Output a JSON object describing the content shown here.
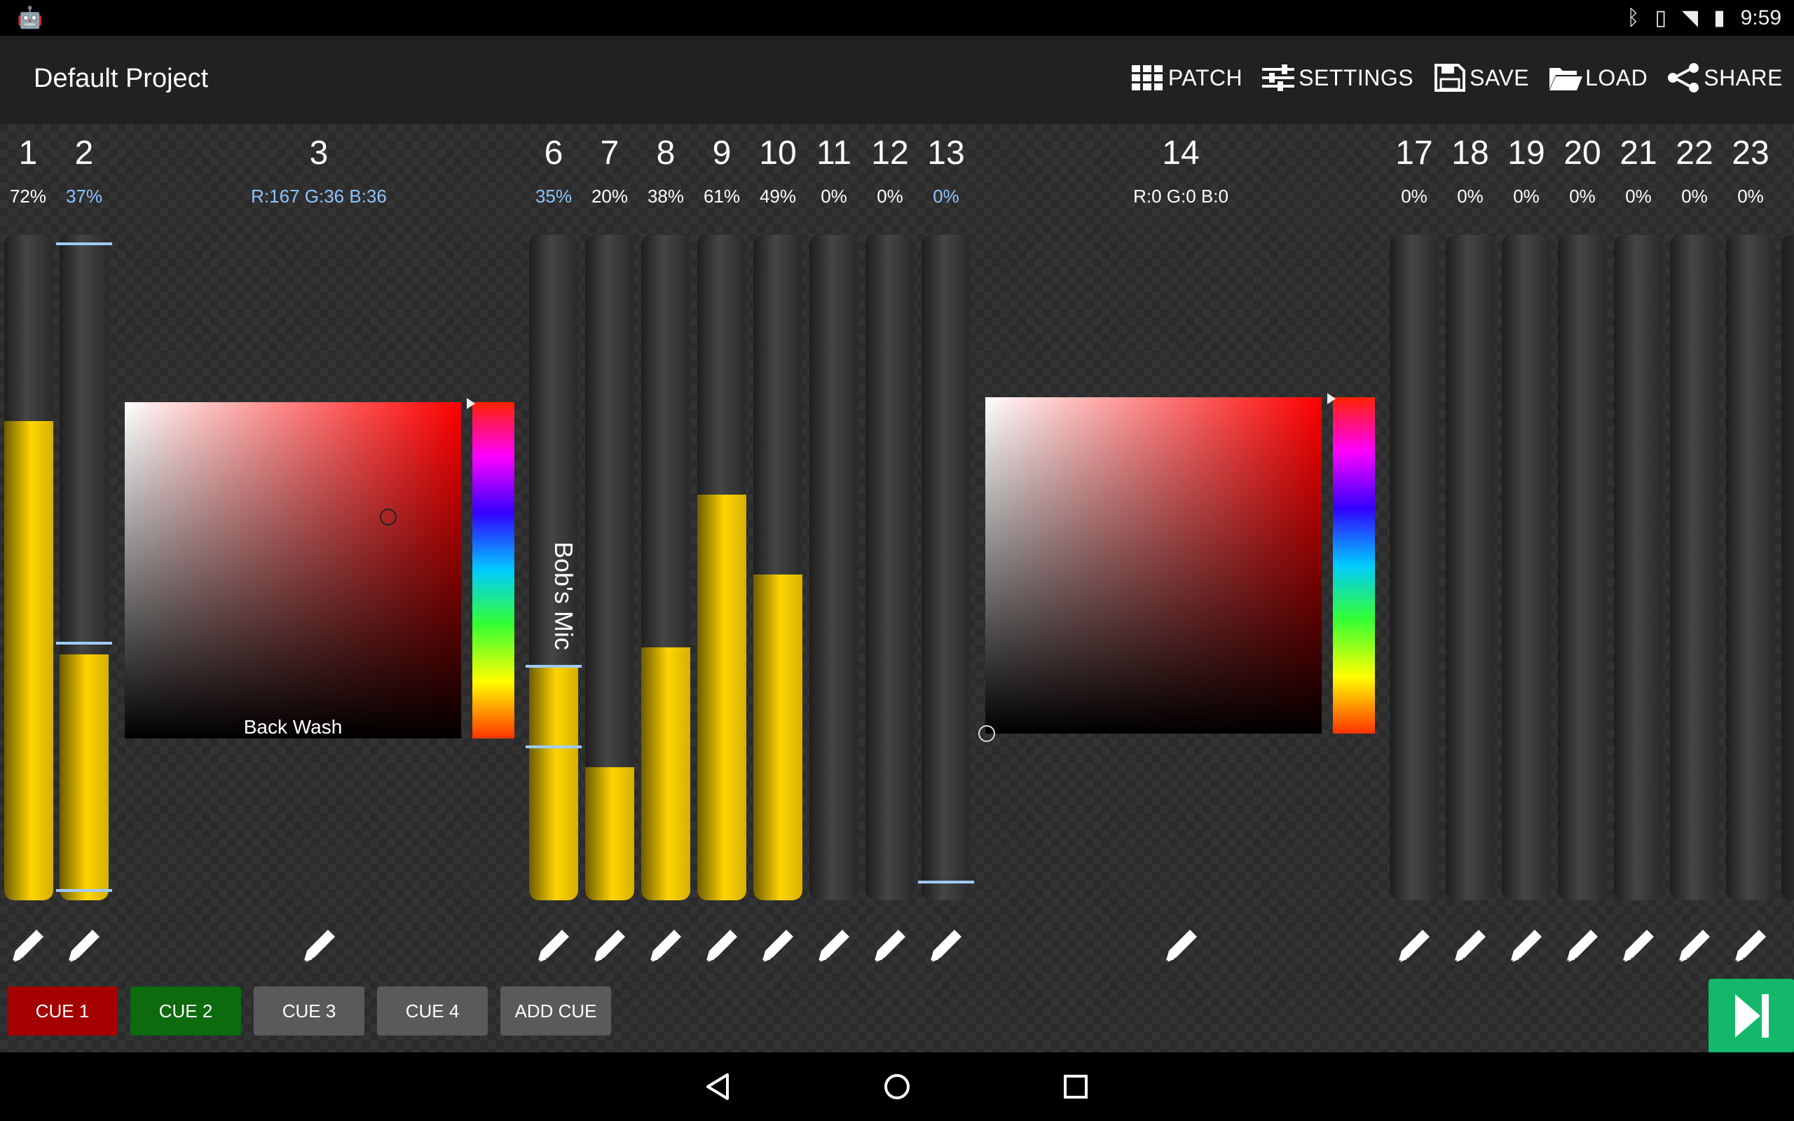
{
  "status": {
    "time": "9:59",
    "icons": [
      "android-icon",
      "bluetooth-icon",
      "vibrate-icon",
      "wifi-icon",
      "battery-charging-icon"
    ]
  },
  "toolbar": {
    "title": "Default Project",
    "actions": {
      "patch": "PATCH",
      "settings": "SETTINGS",
      "save": "SAVE",
      "load": "LOAD",
      "share": "SHARE"
    }
  },
  "channels": [
    {
      "num": "1",
      "value": "72%",
      "level": 0.72
    },
    {
      "num": "2",
      "value": "37%",
      "level": 0.37
    },
    {
      "num": "3",
      "value": "R:167 G:36 B:36",
      "label": "Back Wash"
    },
    {
      "num": "6",
      "value": "35%",
      "level": 0.35,
      "label": "Bob's Mic"
    },
    {
      "num": "7",
      "value": "20%",
      "level": 0.2
    },
    {
      "num": "8",
      "value": "38%",
      "level": 0.38
    },
    {
      "num": "9",
      "value": "61%",
      "level": 0.61
    },
    {
      "num": "10",
      "value": "49%",
      "level": 0.49
    },
    {
      "num": "11",
      "value": "0%",
      "level": 0
    },
    {
      "num": "12",
      "value": "0%",
      "level": 0
    },
    {
      "num": "13",
      "value": "0%",
      "level": 0
    },
    {
      "num": "14",
      "value": "R:0 G:0 B:0"
    },
    {
      "num": "17",
      "value": "0%",
      "level": 0
    },
    {
      "num": "18",
      "value": "0%",
      "level": 0
    },
    {
      "num": "19",
      "value": "0%",
      "level": 0
    },
    {
      "num": "20",
      "value": "0%",
      "level": 0
    },
    {
      "num": "21",
      "value": "0%",
      "level": 0
    },
    {
      "num": "22",
      "value": "0%",
      "level": 0
    },
    {
      "num": "23",
      "value": "0%",
      "level": 0
    }
  ],
  "cues": {
    "cue1": "CUE 1",
    "cue2": "CUE 2",
    "cue3": "CUE 3",
    "cue4": "CUE 4",
    "add": "ADD CUE"
  },
  "colors": {
    "accent_fill": "#ffd500",
    "marker": "#9ecbff",
    "cue_active": "#a50000",
    "cue_next": "#0d6a0d",
    "go": "#13b86a"
  }
}
